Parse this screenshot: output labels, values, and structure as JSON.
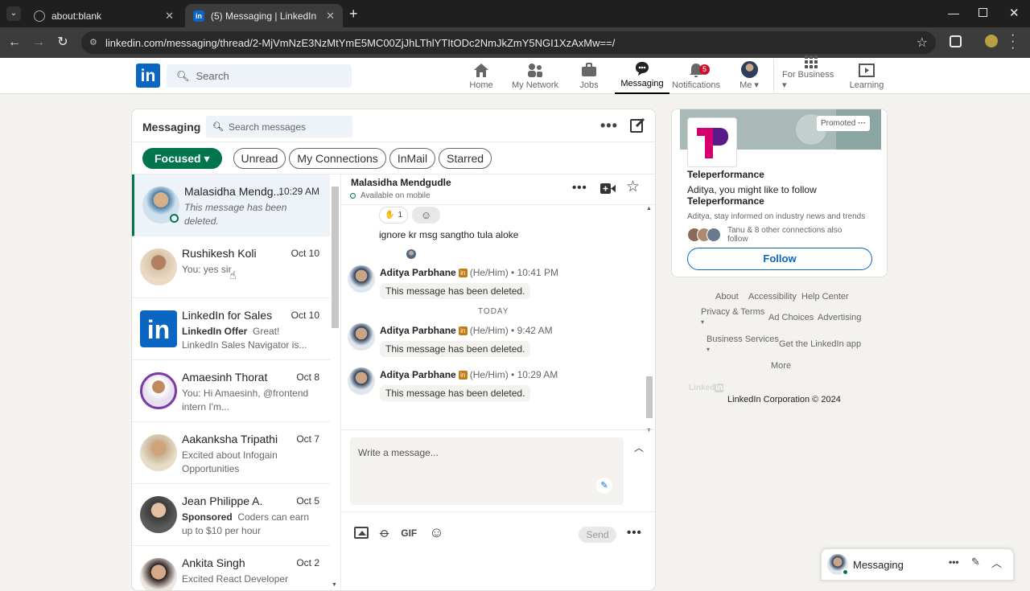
{
  "browser": {
    "tabs": [
      {
        "label": "about:blank"
      },
      {
        "label": "(5) Messaging | LinkedIn"
      }
    ],
    "url": "linkedin.com/messaging/thread/2-MjVmNzE3NzMtYmE5MC00ZjJhLThlYTItODc2NmJkZmY5NGI1XzAxMw==/"
  },
  "linkedin": {
    "search_placeholder": "Search",
    "nav": [
      {
        "label": "Home",
        "icon": "home-icon"
      },
      {
        "label": "My Network",
        "icon": "network-icon"
      },
      {
        "label": "Jobs",
        "icon": "briefcase-icon"
      },
      {
        "label": "Messaging",
        "icon": "chat-icon"
      },
      {
        "label": "Notifications",
        "icon": "bell-icon",
        "badge": "5"
      },
      {
        "label": "Me",
        "icon": "avatar"
      },
      {
        "label": "For Business",
        "icon": "grid-icon"
      },
      {
        "label": "Learning",
        "icon": "play-icon"
      }
    ]
  },
  "messaging": {
    "title": "Messaging",
    "search_placeholder": "Search messages",
    "filters": {
      "focused": "Focused",
      "unread": "Unread",
      "connections": "My Connections",
      "inmail": "InMail",
      "starred": "Starred"
    },
    "conversations": [
      {
        "name": "Malasidha Mendg...",
        "date": "10:29 AM",
        "preview": "This message has been deleted.",
        "color": "#5a7a9a"
      },
      {
        "name": "Rushikesh Koli",
        "date": "Oct 10",
        "preview": "You: yes sir",
        "color": "#8b6a50"
      },
      {
        "name": "LinkedIn for Sales",
        "date": "Oct 10",
        "preview_bold": "LinkedIn Offer",
        "preview": "Great! LinkedIn Sales Navigator is...",
        "color": "#0a66c2"
      },
      {
        "name": "Amaesinh Thorat",
        "date": "Oct 8",
        "preview": "You: Hi Amaesinh, @frontend intern I'm...",
        "color": "#6b4a8a"
      },
      {
        "name": "Aakanksha Tripathi",
        "date": "Oct 7",
        "preview": "Excited about Infogain Opportunities",
        "color": "#a08060"
      },
      {
        "name": "Jean Philippe A.",
        "date": "Oct 5",
        "preview_bold": "Sponsored",
        "preview": "Coders can earn up to $10 per hour",
        "color": "#3a3a3a"
      },
      {
        "name": "Ankita Singh",
        "date": "Oct 2",
        "preview": "Excited React Developer",
        "color": "#7a5a4a"
      }
    ],
    "thread": {
      "name": "Malasidha Mendgudle",
      "status": "Available on mobile",
      "reaction_count": "1",
      "text_message": "ignore kr msg sangtho tula aloke",
      "messages": [
        {
          "sender": "Aditya Parbhane",
          "pronouns": "(He/Him)",
          "time": "• 10:41 PM",
          "text": "This message has been deleted."
        },
        {
          "sender": "Aditya Parbhane",
          "pronouns": "(He/Him)",
          "time": "• 9:42 AM",
          "text": "This message has been deleted."
        },
        {
          "sender": "Aditya Parbhane",
          "pronouns": "(He/Him)",
          "time": "• 10:29 AM",
          "text": "This message has been deleted."
        }
      ],
      "divider": "TODAY",
      "compose_placeholder": "Write a message...",
      "send_label": "Send",
      "gif_label": "GIF"
    }
  },
  "ad": {
    "promoted": "Promoted",
    "company": "Teleperformance",
    "line1": "Aditya, you might like to follow",
    "line1_company": "Teleperformance",
    "desc": "Aditya, stay informed on industry news and trends",
    "connections": "Tanu & 8 other connections also follow",
    "follow": "Follow",
    "brand_color": "#d6006f"
  },
  "footer": {
    "about": "About",
    "accessibility": "Accessibility",
    "help": "Help Center",
    "privacy": "Privacy & Terms",
    "adchoices": "Ad Choices",
    "advertising": "Advertising",
    "business": "Business Services",
    "getapp": "Get the LinkedIn app",
    "more": "More",
    "corp": "LinkedIn Corporation © 2024"
  },
  "minibar": {
    "label": "Messaging"
  },
  "colors": {
    "accent": "#0a66c2",
    "focused_green": "#01754f"
  }
}
